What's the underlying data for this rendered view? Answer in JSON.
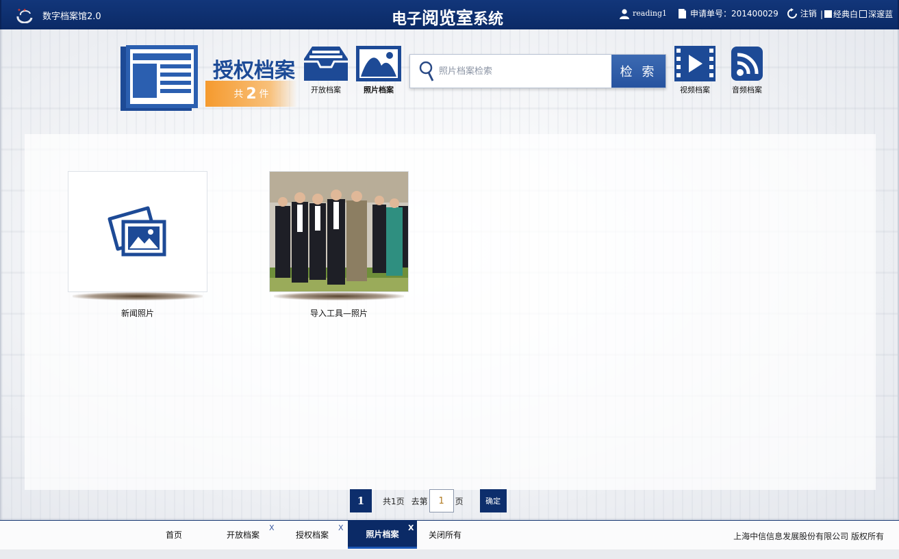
{
  "topbar": {
    "app_name": "数字档案馆2.0",
    "system_title_a": "电子",
    "system_title_b": "阅览室",
    "system_title_c": "系统",
    "username": "reading1",
    "request_label": "申请单号：201400029",
    "logout_label": "注销",
    "skin_options": [
      "经典白",
      "深邃蓝"
    ],
    "skin_separator": "|"
  },
  "header": {
    "section_title": "授权档案",
    "count_prefix": "共",
    "count_value": "2",
    "count_suffix": "件",
    "nav": {
      "open_archives": "开放档案",
      "photo_archives": "照片档案",
      "video_archives": "视频档案",
      "audio_archives": "音频档案"
    },
    "search": {
      "placeholder": "照片档案检索",
      "button_label": "检 索"
    }
  },
  "cards": [
    {
      "caption": "新闻照片"
    },
    {
      "caption": "导入工具—照片"
    }
  ],
  "pagination": {
    "current_page": "1",
    "total_text": "共1页",
    "goto_label": "去第",
    "goto_value": "1",
    "page_suffix": "页",
    "confirm_label": "确定"
  },
  "bottom_tabs": {
    "home": "首页",
    "open": "开放档案",
    "authorized": "授权档案",
    "photo": "照片档案",
    "close_all": "关闭所有",
    "close_mark": "X"
  },
  "footer": {
    "copyright": "上海中信信息发展股份有限公司  版权所有"
  },
  "colors": {
    "topbar_bg": "#0b2a66",
    "brand_blue": "#1c4a96",
    "count_orange": "#f59a2e"
  }
}
